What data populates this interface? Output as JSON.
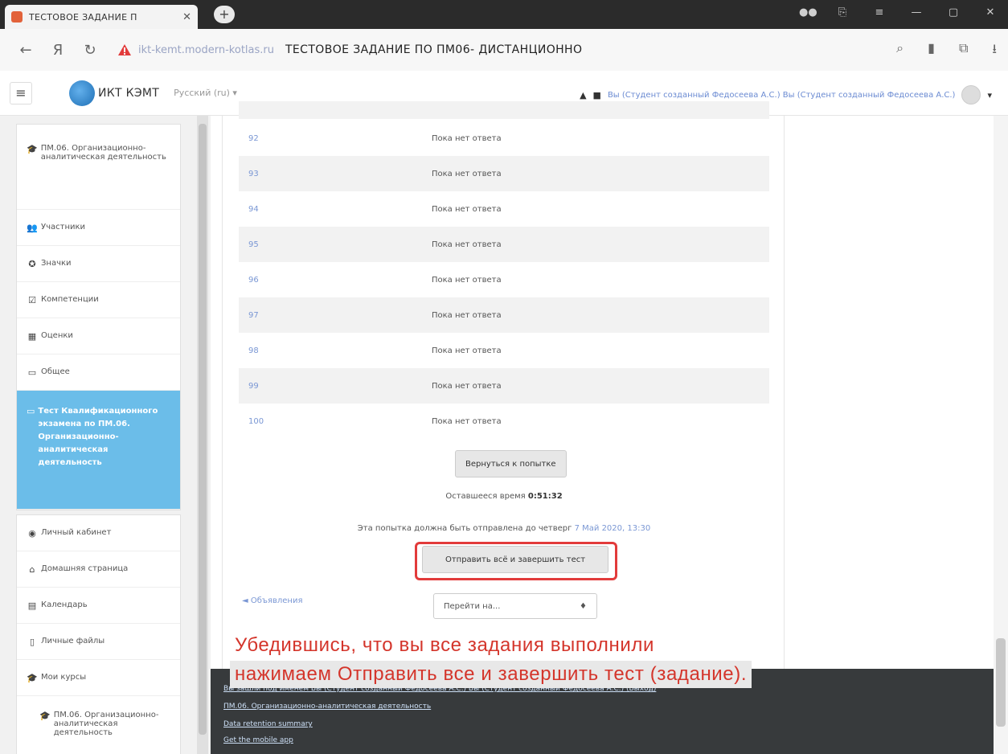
{
  "browser": {
    "tab_title": "ТЕСТОВОЕ ЗАДАНИЕ П",
    "address_host": "ikt-kemt.modern-kotlas.ru",
    "address_title": "ТЕСТОВОЕ ЗАДАНИЕ ПО ПМ06- ДИСТАНЦИОННО"
  },
  "navbar": {
    "site_name": "ИКТ КЭМТ",
    "language": "Русский (ru) ▾",
    "user_text": "Вы (Студент созданный Федосеева А.С.) Вы (Студент созданный Федосеева А.С.)"
  },
  "sidebar": {
    "items": [
      {
        "label": "ПМ.06. Организационно-аналитическая деятельность",
        "icon": "graduation-cap-icon"
      },
      {
        "label": "Участники",
        "icon": "users-icon"
      },
      {
        "label": "Значки",
        "icon": "badge-icon"
      },
      {
        "label": "Компетенции",
        "icon": "checkbox-icon"
      },
      {
        "label": "Оценки",
        "icon": "grid-icon"
      },
      {
        "label": "Общее",
        "icon": "folder-icon"
      },
      {
        "label": "Тест Квалификационного экзамена по ПМ.06. Организационно-аналитическая деятельность",
        "icon": "folder-icon",
        "active": true
      }
    ],
    "items2": [
      {
        "label": "Личный кабинет",
        "icon": "dashboard-icon"
      },
      {
        "label": "Домашняя страница",
        "icon": "home-icon"
      },
      {
        "label": "Календарь",
        "icon": "calendar-icon"
      },
      {
        "label": "Личные файлы",
        "icon": "file-icon"
      },
      {
        "label": "Мои курсы",
        "icon": "graduation-cap-icon"
      },
      {
        "label": "ПМ.06. Организационно-аналитическая деятельность",
        "icon": "graduation-cap-icon"
      }
    ]
  },
  "summary": {
    "rows": [
      {
        "q": "92",
        "status": "Пока нет ответа"
      },
      {
        "q": "93",
        "status": "Пока нет ответа"
      },
      {
        "q": "94",
        "status": "Пока нет ответа"
      },
      {
        "q": "95",
        "status": "Пока нет ответа"
      },
      {
        "q": "96",
        "status": "Пока нет ответа"
      },
      {
        "q": "97",
        "status": "Пока нет ответа"
      },
      {
        "q": "98",
        "status": "Пока нет ответа"
      },
      {
        "q": "99",
        "status": "Пока нет ответа"
      },
      {
        "q": "100",
        "status": "Пока нет ответа"
      }
    ],
    "return_button": "Вернуться к попытке",
    "time_left_label": "Оставшееся время",
    "time_left_value": "0:51:32",
    "due_text": "Эта попытка должна быть отправлена до четверг",
    "due_date": "7 Май 2020, 13:30",
    "submit_button": "Отправить всё и завершить тест",
    "prev_link": "◄ Объявления",
    "jump_placeholder": "Перейти на...",
    "jump_arrow": "♦"
  },
  "footer": {
    "line1": "Вы зашли под именем Вы (Студент созданный Федосеева А.С.) Вы (Студент созданный Федосеева А.С.) (Выход)",
    "line2": "ПМ.06. Организационно-аналитическая деятельность",
    "line3": "Data retention summary",
    "line4": "Get the mobile app"
  },
  "caption": {
    "line1": "Убедившись, что вы все задания выполнили",
    "line2": "нажимаем Отправить все и завершить тест (задание)."
  },
  "colors": {
    "accent": "#6bbde9",
    "highlight": "#e23b3b",
    "link": "#7a97d4",
    "footer": "#373a3c"
  }
}
